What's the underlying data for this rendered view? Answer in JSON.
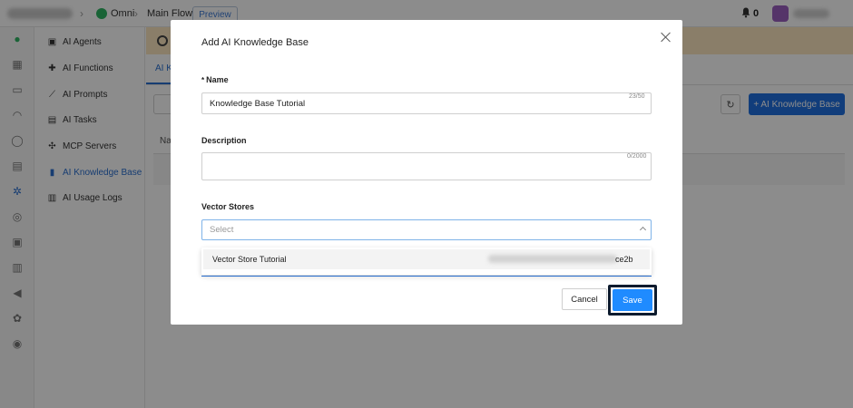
{
  "topbar": {
    "breadcrumb": [
      "Omni",
      "Main Flow"
    ],
    "preview_label": "Preview",
    "notification_count": "0"
  },
  "sidebar": {
    "items": [
      {
        "label": "AI Agents",
        "icon": "robot-icon"
      },
      {
        "label": "AI Functions",
        "icon": "puzzle-icon"
      },
      {
        "label": "AI Prompts",
        "icon": "magic-wand-icon"
      },
      {
        "label": "AI Tasks",
        "icon": "clipboard-icon"
      },
      {
        "label": "MCP Servers",
        "icon": "server-icon"
      },
      {
        "label": "AI Knowledge Base",
        "icon": "book-icon",
        "active": true
      },
      {
        "label": "AI Usage Logs",
        "icon": "bar-chart-icon"
      }
    ]
  },
  "main": {
    "tab_label": "AI K",
    "add_button_label": "+ AI Knowledge Base",
    "table_header_first": "Na"
  },
  "modal": {
    "title": "Add AI Knowledge Base",
    "name": {
      "label": "Name",
      "value": "Knowledge Base Tutorial",
      "count": "23/50"
    },
    "description": {
      "label": "Description",
      "value": "",
      "count": "0/2000"
    },
    "vector_stores": {
      "label": "Vector Stores",
      "placeholder": "Select",
      "options": [
        {
          "label": "Vector Store Tutorial",
          "id_tail": "ce2b"
        }
      ]
    },
    "cancel_label": "Cancel",
    "save_label": "Save"
  },
  "colors": {
    "primary": "#1f6fe0",
    "save": "#1f8bff",
    "banner": "#fbe6bf",
    "focus_outline": "#0d1b2e"
  }
}
